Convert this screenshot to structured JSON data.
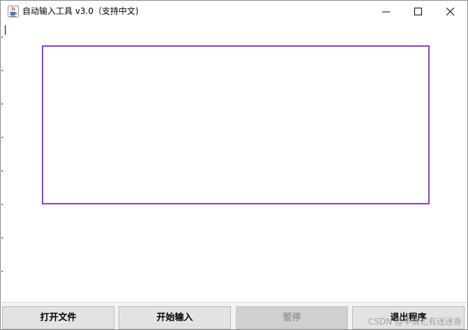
{
  "window": {
    "title": "自动输入工具 v3.0（支持中文)"
  },
  "buttons": {
    "open_file": "打开文件",
    "start_input": "开始输入",
    "pause": "暂停",
    "exit": "退出程序"
  },
  "watermark": {
    "text": "CSDN @半情忆有迷迷香"
  },
  "colors": {
    "selection_border": "#8e3fc6",
    "button_background": "#e3e3e3",
    "disabled_text": "#9a9a9a"
  },
  "icons": {
    "app": "java-cup-icon",
    "minimize": "minimize-icon",
    "maximize": "maximize-icon",
    "close": "close-icon"
  }
}
